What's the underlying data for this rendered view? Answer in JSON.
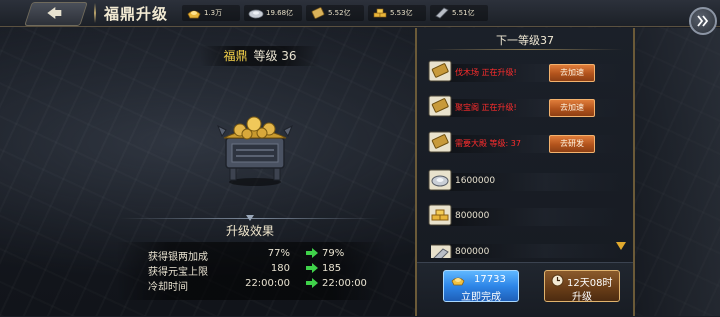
{
  "colors": {
    "accent_gold": "#f5d24a",
    "warning_red": "#ff2d2d",
    "arrow_green": "#3fd24a",
    "button_blue": "#2e86e8",
    "button_orange": "#b2531c"
  },
  "header": {
    "title": "福鼎升级",
    "back_icon": "back-arrow-icon",
    "resources": [
      {
        "icon": "ingot-icon",
        "value": "1.3万"
      },
      {
        "icon": "silver-icon",
        "value": "19.68亿"
      },
      {
        "icon": "scroll-icon",
        "value": "5.52亿"
      },
      {
        "icon": "gold-ingots-icon",
        "value": "5.53亿"
      },
      {
        "icon": "iron-icon",
        "value": "5.51亿"
      }
    ],
    "expand_icon": "double-chevron-icon"
  },
  "item": {
    "name": "福鼎",
    "level": "等级 36",
    "icon": "cauldron-icon"
  },
  "effects": {
    "title": "升级效果",
    "rows": [
      {
        "label": "获得银两加成",
        "current": "77%",
        "next": "79%"
      },
      {
        "label": "获得元宝上限",
        "current": "180",
        "next": "185"
      },
      {
        "label": "冷却时间",
        "current": "22:00:00",
        "next": "22:00:00"
      }
    ]
  },
  "requirements": {
    "title": "下一等级37",
    "rows": [
      {
        "icon": "scroll-icon",
        "text": "伐木场 正在升级!",
        "button": "去加速"
      },
      {
        "icon": "scroll-icon",
        "text": "聚宝阁 正在升级!",
        "button": "去加速"
      },
      {
        "icon": "scroll-icon",
        "text": "需要大殿 等级: 37",
        "button": "去研发"
      },
      {
        "icon": "silver-icon",
        "amount": "1600000"
      },
      {
        "icon": "gold-ingots-icon",
        "amount": "800000"
      },
      {
        "icon": "iron-icon",
        "amount": "800000"
      }
    ]
  },
  "actions": {
    "instant": {
      "cost": "17733",
      "label": "立即完成",
      "icon": "ingot-icon"
    },
    "upgrade": {
      "time": "12天08时",
      "label": "升级",
      "icon": "clock-icon"
    }
  }
}
